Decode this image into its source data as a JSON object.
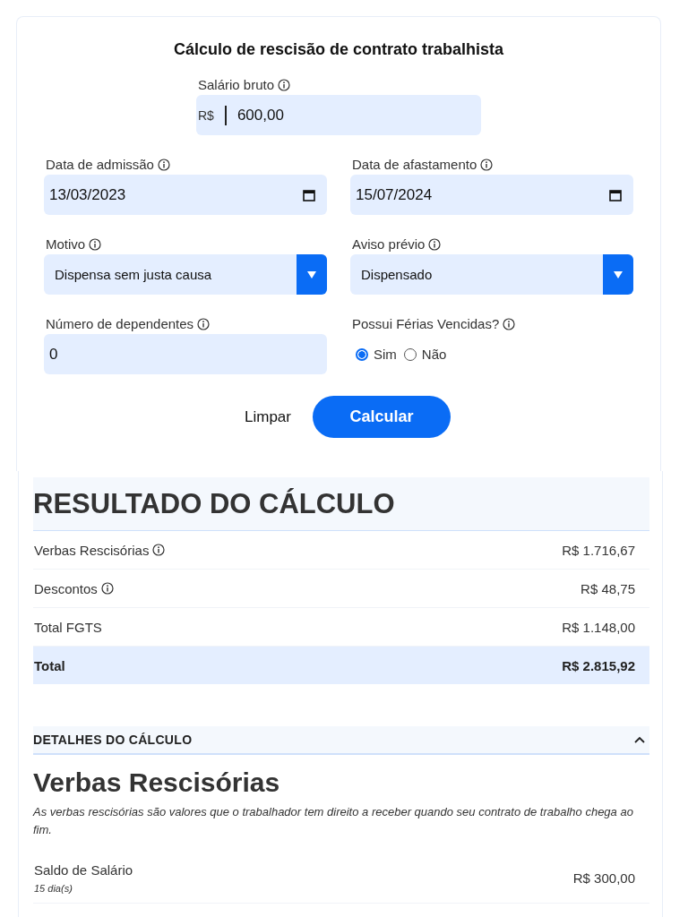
{
  "title": "Cálculo de rescisão de contrato trabalhista",
  "salary": {
    "label": "Salário bruto",
    "info": true,
    "prefix": "R$",
    "value": "600,00"
  },
  "dates": [
    {
      "label": "Data de admissão",
      "info": true,
      "value": "13/03/2023"
    },
    {
      "label": "Data de afastamento",
      "info": true,
      "value": "15/07/2024"
    }
  ],
  "selects": [
    {
      "label": "Motivo",
      "info": true,
      "value": "Dispensa sem justa causa"
    },
    {
      "label": "Aviso prévio",
      "info": true,
      "value": "Dispensado"
    }
  ],
  "dependents": {
    "label": "Número de dependentes",
    "info": true,
    "value": "0"
  },
  "vacation": {
    "label": "Possui Férias Vencidas?",
    "info": true,
    "options": [
      {
        "label": "Sim",
        "selected": true
      },
      {
        "label": "Não",
        "selected": false
      }
    ]
  },
  "buttons": {
    "clear": "Limpar",
    "submit": "Calcular"
  },
  "result": {
    "title": "RESULTADO DO CÁLCULO",
    "rows": [
      {
        "label": "Verbas Rescisórias",
        "info": true,
        "value": "R$ 1.716,67",
        "kind": "normal"
      },
      {
        "label": "Descontos",
        "info": true,
        "value": "R$ 48,75",
        "kind": "normal"
      },
      {
        "label": "Total FGTS",
        "info": false,
        "value": "R$ 1.148,00",
        "kind": "normal"
      },
      {
        "label": "Total",
        "info": false,
        "value": "R$ 2.815,92",
        "kind": "total"
      }
    ]
  },
  "details": {
    "title": "DETALHES DO CÁLCULO",
    "expanded": true,
    "section_title": "Verbas Rescisórias",
    "description": "As verbas rescisórias são valores que o trabalhador tem direito a receber quando seu contrato de trabalho chega ao fim.",
    "items": [
      {
        "label": "Saldo de Salário",
        "note": "15 dia(s)",
        "value": "R$ 300,00"
      }
    ]
  }
}
